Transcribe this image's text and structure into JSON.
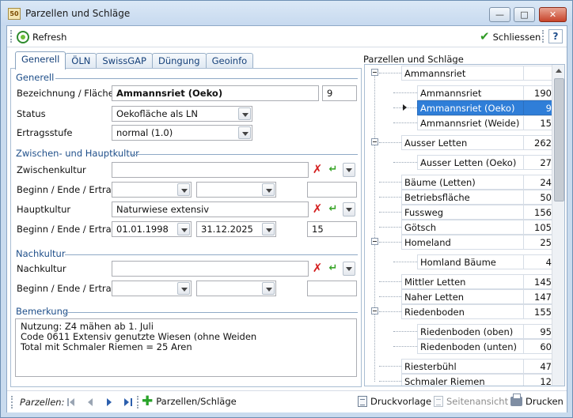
{
  "window": {
    "title": "Parzellen und Schläge",
    "icon": "app-grid-icon"
  },
  "toolbar": {
    "refresh": "Refresh",
    "close": "Schliessen",
    "help": "?"
  },
  "tabs": [
    "Generell",
    "ÖLN",
    "SwissGAP",
    "Düngung",
    "Geoinfo"
  ],
  "form": {
    "sec_generell": "Generell",
    "bezeichnung_label": "Bezeichnung / Fläche",
    "bezeichnung_value": "Ammannsriet (Oeko)",
    "flaeche_value": "9",
    "status_label": "Status",
    "status_value": "Oekofläche als LN",
    "ertrag_label": "Ertragsstufe",
    "ertrag_value": "normal (1.0)",
    "sec_kultur": "Zwischen- und Hauptkultur",
    "zwischen_label": "Zwischenkultur",
    "zwischen_value": "",
    "bee_label": "Beginn / Ende / Ertrag",
    "zk_begin": "",
    "zk_ende": "",
    "zk_ertrag": "",
    "haupt_label": "Hauptkultur",
    "haupt_value": "Naturwiese extensiv",
    "hk_begin": "01.01.1998",
    "hk_ende": "31.12.2025",
    "hk_ertrag": "15",
    "sec_nach": "Nachkultur",
    "nach_label": "Nachkultur",
    "nach_value": "",
    "nk_begin": "",
    "nk_ende": "",
    "nk_ertrag": "",
    "sec_bemerkung": "Bemerkung",
    "memo_lines": [
      "Nutzung: Z4 mähen ab 1. Juli",
      "Code 0611 Extensiv genutzte Wiesen (ohne Weiden",
      "Total mit Schmaler Riemen = 25 Aren"
    ]
  },
  "tree": {
    "title": "Parzellen und Schläge",
    "rows": [
      {
        "name": "Ammannsriet",
        "value": "",
        "level": 0,
        "toggle": true
      },
      {
        "name": "Ammannsriet",
        "value": "190",
        "level": 1
      },
      {
        "name": "Ammannsriet (Oeko)",
        "value": "9",
        "level": 1,
        "selected": true
      },
      {
        "name": "Ammannsriet (Weide)",
        "value": "15",
        "level": 1
      },
      {
        "name": "Ausser Letten",
        "value": "262",
        "level": 0,
        "toggle": true
      },
      {
        "name": "Ausser Letten (Oeko)",
        "value": "27",
        "level": 1
      },
      {
        "name": "Bäume (Letten)",
        "value": "24",
        "level": 0
      },
      {
        "name": "Betriebsfläche",
        "value": "50",
        "level": 0
      },
      {
        "name": "Fussweg",
        "value": "156",
        "level": 0
      },
      {
        "name": "Götsch",
        "value": "105",
        "level": 0
      },
      {
        "name": "Homeland",
        "value": "25",
        "level": 0,
        "toggle": true
      },
      {
        "name": "Homland Bäume",
        "value": "4",
        "level": 1
      },
      {
        "name": "Mittler Letten",
        "value": "145",
        "level": 0
      },
      {
        "name": "Naher Letten",
        "value": "147",
        "level": 0
      },
      {
        "name": "Riedenboden",
        "value": "155",
        "level": 0,
        "toggle": true
      },
      {
        "name": "Riedenboden (oben)",
        "value": "95",
        "level": 1
      },
      {
        "name": "Riedenboden (unten)",
        "value": "60",
        "level": 1
      },
      {
        "name": "Riesterbühl",
        "value": "47",
        "level": 0
      },
      {
        "name": "Schmaler Riemen",
        "value": "12",
        "level": 0
      }
    ]
  },
  "bottom": {
    "nav_label": "Parzellen:",
    "parzellen": "Parzellen/Schläge",
    "druckvorlage": "Druckvorlage",
    "seitenansicht": "Seitenansicht",
    "drucken": "Drucken"
  },
  "colors": {
    "selection": "#2f7ed8",
    "section": "#1f4f8a",
    "tab_text": "#16417a"
  }
}
